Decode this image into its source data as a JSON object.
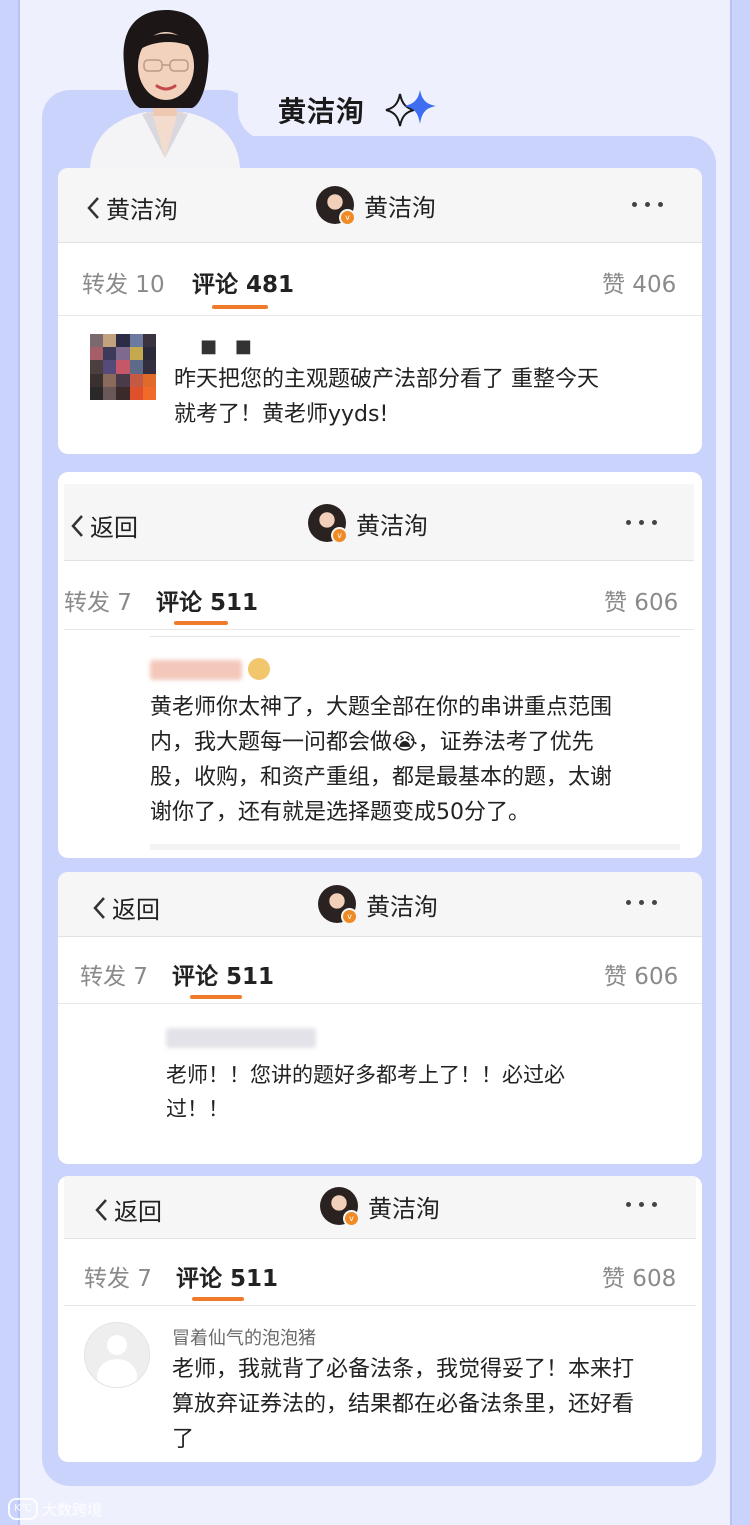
{
  "header": {
    "teacher_name": "黄洁洵"
  },
  "cards": [
    {
      "back_label": "黄洁洵",
      "profile_name": "黄洁洵",
      "repost_label": "转发 10",
      "comment_label": "评论 481",
      "like_label": "赞 406",
      "user_name": "■ ■",
      "comment": [
        "昨天把您的主观题破产法部分看了 重整今天",
        "就考了！黄老师yyds!"
      ]
    },
    {
      "back_label": "返回",
      "profile_name": "黄洁洵",
      "repost_label": "转发 7",
      "comment_label": "评论 511",
      "like_label": "赞 606",
      "comment": [
        "黄老师你太神了，大题全部在你的串讲重点范围",
        "内，我大题每一问都会做😭，证券法考了优先",
        "股，收购，和资产重组，都是最基本的题，太谢",
        "谢你了，还有就是选择题变成50分了。"
      ]
    },
    {
      "back_label": "返回",
      "profile_name": "黄洁洵",
      "repost_label": "转发 7",
      "comment_label": "评论 511",
      "like_label": "赞 606",
      "comment": [
        "老师！！您讲的题好多都考上了！！必过必",
        "过！！"
      ]
    },
    {
      "back_label": "返回",
      "profile_name": "黄洁洵",
      "repost_label": "转发 7",
      "comment_label": "评论 511",
      "like_label": "赞 608",
      "user_name": "冒着仙气的泡泡猪",
      "comment": [
        "老师，我就背了必备法条，我觉得妥了！本来打",
        "算放弃证券法的，结果都在必备法条里，还好看",
        "了"
      ]
    }
  ],
  "watermark": {
    "logo": "K℃",
    "text": "大数跨境"
  },
  "colors": {
    "accent": "#f07b2a",
    "frame": "#c9d3fb",
    "sparkle": "#3f6df2"
  }
}
